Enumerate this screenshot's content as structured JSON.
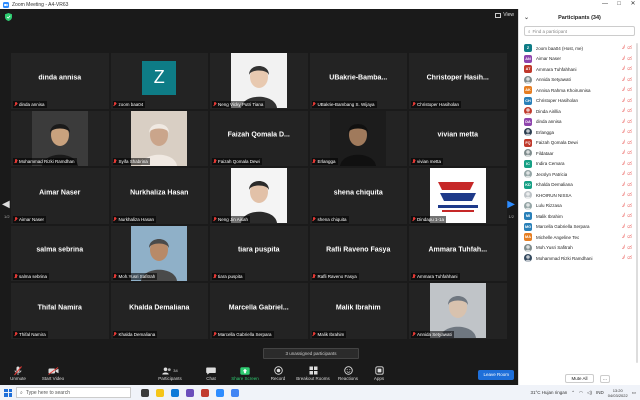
{
  "window": {
    "title": "Zoom Meeting - A4-VR63",
    "view_label": "View",
    "min": "—",
    "max": "□",
    "close": "✕"
  },
  "tiles": [
    {
      "big": "dinda annisa",
      "tag": "dinda annisa",
      "kind": "name"
    },
    {
      "big": "",
      "tag": "zoom baa04",
      "kind": "avatar",
      "letter": "Z"
    },
    {
      "big": "",
      "tag": "Neng Vicky Putri Tiana",
      "kind": "photo"
    },
    {
      "big": "UBakrie-Bamba...",
      "tag": "UBakrie-Bambang S. Wijaya",
      "kind": "name"
    },
    {
      "big": "Christoper Hasih...",
      "tag": "Christoper Hasiholan",
      "kind": "name"
    },
    {
      "big": "",
      "tag": "Mohammad Rizki Ramdhan",
      "kind": "photo"
    },
    {
      "big": "",
      "tag": "Syifa Shabrina",
      "kind": "photo"
    },
    {
      "big": "Faizah Qomala D...",
      "tag": "Faizah Qomala Dewi",
      "kind": "name"
    },
    {
      "big": "",
      "tag": "Erlangga",
      "kind": "photo"
    },
    {
      "big": "vivian metta",
      "tag": "vivian metta",
      "kind": "name"
    },
    {
      "big": "Aimar Naser",
      "tag": "Aimar Naser",
      "kind": "name"
    },
    {
      "big": "Nurkhaliza Hasan",
      "tag": "Nurkhaliza Hasan",
      "kind": "name"
    },
    {
      "big": "",
      "tag": "Neng Jin Aisah",
      "kind": "photo"
    },
    {
      "big": "shena chiquita",
      "tag": "shena chiquita",
      "kind": "name"
    },
    {
      "big": "",
      "tag": "Dindapu 1-1a",
      "kind": "logo"
    },
    {
      "big": "salma sebrina",
      "tag": "salma sebrina",
      "kind": "name"
    },
    {
      "big": "",
      "tag": "Moh.Yusri Safitrah",
      "kind": "photo"
    },
    {
      "big": "tiara puspita",
      "tag": "tiara puspita",
      "kind": "name"
    },
    {
      "big": "Rafli Raveno Fasya",
      "tag": "Rafli Raveno Fasya",
      "kind": "name"
    },
    {
      "big": "Ammara Tuhfah...",
      "tag": "Ammara Tuhfahhani",
      "kind": "name"
    },
    {
      "big": "Thifal Namira",
      "tag": "Thifal Namira",
      "kind": "name"
    },
    {
      "big": "Khalda Demaliana",
      "tag": "Khalda Demaliana",
      "kind": "name"
    },
    {
      "big": "Marcella Gabriel...",
      "tag": "Marcella Gabriella Serpara",
      "kind": "name"
    },
    {
      "big": "Malik Ibrahim",
      "tag": "Malik Ibrahim",
      "kind": "name"
    },
    {
      "big": "",
      "tag": "Annida Setyawati",
      "kind": "photo"
    }
  ],
  "pager": {
    "left": "1/2",
    "right": "1/2"
  },
  "toast": "3 unassigned participants",
  "toolbar": {
    "unmute": "Unmute",
    "start_video": "Start Video",
    "participants": "Participants",
    "participants_count": "34",
    "chat": "Chat",
    "share": "Share Screen",
    "record": "Record",
    "breakout": "Breakout Rooms",
    "reactions": "Reactions",
    "apps": "Apps",
    "leave": "Leave Room"
  },
  "panel": {
    "title": "Participants (34)",
    "search_placeholder": "Find a participant",
    "mute_all": "Mute All",
    "more": "...",
    "participants": [
      {
        "initials": "Z",
        "name": "zoom baa04 (Host, me)",
        "color": "#0e7c86"
      },
      {
        "initials": "AN",
        "name": "Aimar Naser",
        "color": "#8e44ad"
      },
      {
        "initials": "AT",
        "name": "Ammara Tuhfahhani",
        "color": "#c0392b"
      },
      {
        "initials": "",
        "name": "Annida Setyawati",
        "color": "#7f8c8d",
        "photo": true
      },
      {
        "initials": "AK",
        "name": "Annisa Rahma Khoirunnisa",
        "color": "#e67e22"
      },
      {
        "initials": "CH",
        "name": "Christoper Hasiholan",
        "color": "#2980b9"
      },
      {
        "initials": "",
        "name": "Dinda Airillia",
        "color": "#c0392b",
        "photo": true
      },
      {
        "initials": "DA",
        "name": "dinda annisa",
        "color": "#8e44ad"
      },
      {
        "initials": "",
        "name": "Erlangga",
        "color": "#2c3e50",
        "photo": true
      },
      {
        "initials": "FQ",
        "name": "Faizah Qomala Dewi",
        "color": "#c0392b"
      },
      {
        "initials": "",
        "name": "Fildataar",
        "color": "#7f8c8d",
        "photo": true
      },
      {
        "initials": "IC",
        "name": "Indira Cemara",
        "color": "#16a085"
      },
      {
        "initials": "",
        "name": "Jecslyn Patricia",
        "color": "#95a5a6",
        "photo": true
      },
      {
        "initials": "KD",
        "name": "Khalda Demaliana",
        "color": "#16a085"
      },
      {
        "initials": "",
        "name": "KHOIRUN NISSA",
        "color": "#bdc3c7",
        "photo": true
      },
      {
        "initials": "",
        "name": "Lulu Rizzasa",
        "color": "#95a5a6",
        "photo": true
      },
      {
        "initials": "MI",
        "name": "Malik Ibrahim",
        "color": "#2980b9"
      },
      {
        "initials": "MG",
        "name": "Marcella Gabriella Serpara",
        "color": "#2980b9"
      },
      {
        "initials": "MA",
        "name": "Michelle Angeline Teo",
        "color": "#e67e22"
      },
      {
        "initials": "",
        "name": "Moh.Yusri Safitrah",
        "color": "#7f8c8d",
        "photo": true
      },
      {
        "initials": "",
        "name": "Mohammad Rizki Ramdhani",
        "color": "#34495e",
        "photo": true
      }
    ]
  },
  "taskbar": {
    "search_placeholder": "Type here to search",
    "weather": "31°C  Hujan ringan",
    "lang": "IND",
    "time": "13:20",
    "date": "04/03/2022"
  }
}
